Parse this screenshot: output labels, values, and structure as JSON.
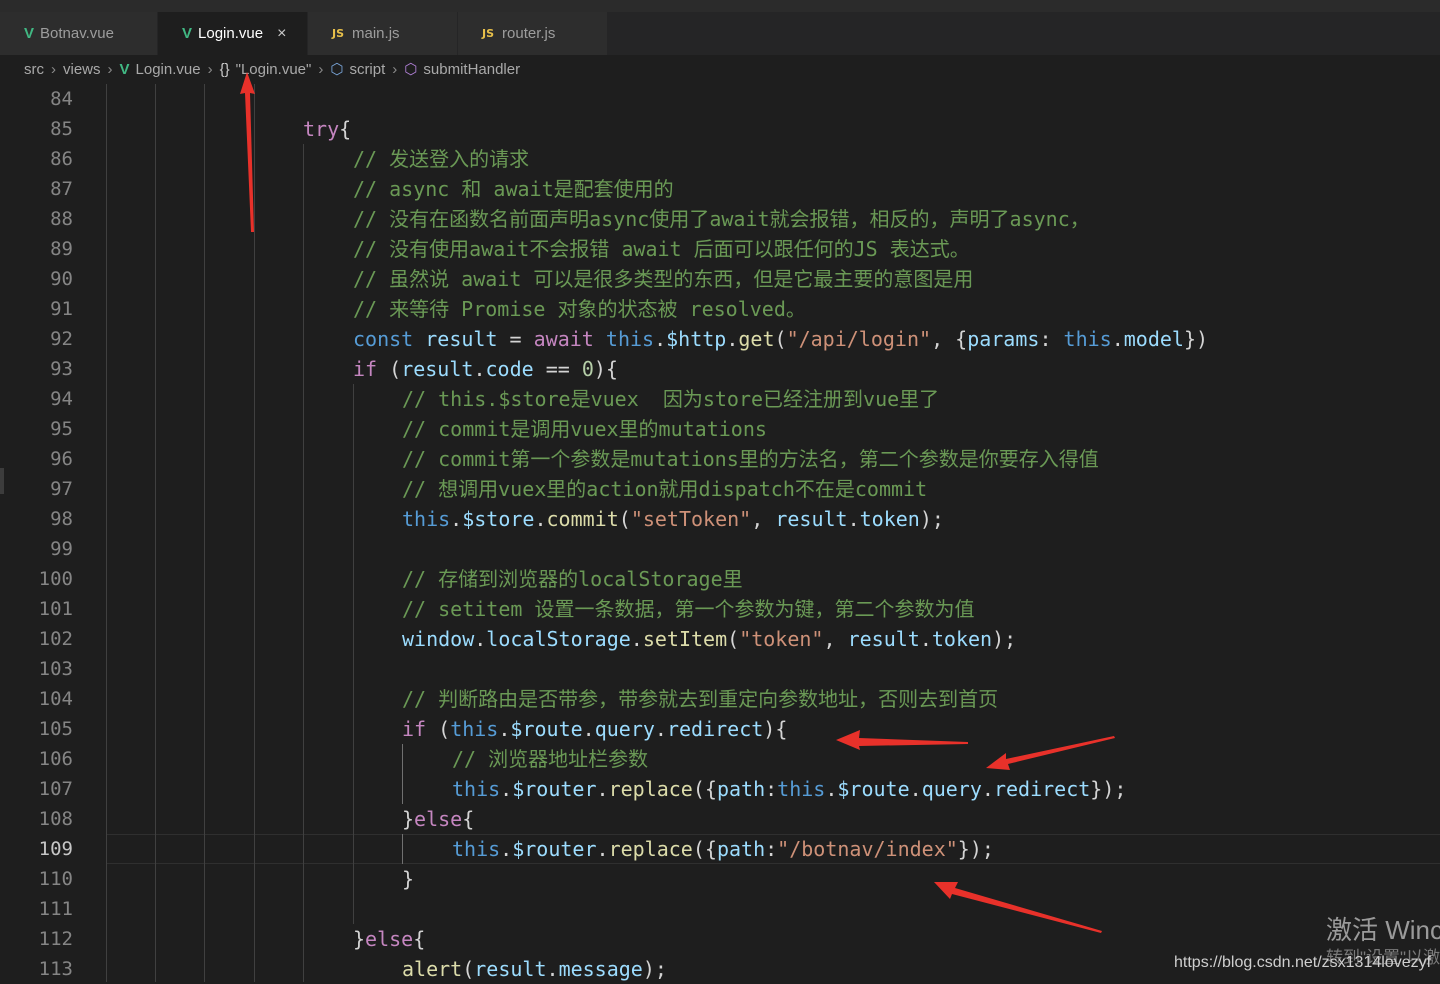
{
  "tabs": [
    {
      "label": "Botnav.vue",
      "icon": "vue-icon"
    },
    {
      "label": "Login.vue",
      "icon": "vue-icon",
      "close": "×"
    },
    {
      "label": "main.js",
      "icon": "js-icon",
      "icon_text": "JS"
    },
    {
      "label": "router.js",
      "icon": "js-icon",
      "icon_text": "JS"
    }
  ],
  "breadcrumb": {
    "src": "src",
    "views": "views",
    "file": "Login.vue",
    "component": "\"Login.vue\"",
    "script": "script",
    "method": "submitHandler",
    "braces": "{}"
  },
  "editor": {
    "current_line": "109",
    "line_numbers": [
      "84",
      "85",
      "86",
      "87",
      "88",
      "89",
      "90",
      "91",
      "92",
      "93",
      "94",
      "95",
      "96",
      "97",
      "98",
      "99",
      "100",
      "101",
      "102",
      "103",
      "104",
      "105",
      "106",
      "107",
      "108",
      "109",
      "110",
      "111",
      "112",
      "113"
    ],
    "tokens": {
      "l85": {
        "try": "try",
        "brace": "{"
      },
      "l86": "// 发送登入的请求",
      "l87": "// async 和 await是配套使用的",
      "l88": "// 没有在函数名前面声明async使用了await就会报错，相反的，声明了async，",
      "l89": "// 没有使用await不会报错 await 后面可以跟任何的JS 表达式。",
      "l90": "// 虽然说 await 可以是很多类型的东西，但是它最主要的意图是用",
      "l91": "// 来等待 Promise 对象的状态被 resolved。",
      "l92": {
        "const": "const",
        "result": "result",
        "eq": " = ",
        "await": "await",
        "this": "this",
        "dot1": ".",
        "http": "$http",
        "dot2": ".",
        "get": "get",
        "p1": "(",
        "url": "\"/api/login\"",
        "p2": ", {",
        "params": "params",
        "colon": ": ",
        "this2": "this",
        "dot3": ".",
        "model": "model",
        "p3": "})"
      },
      "l93": {
        "if": "if",
        "p1": " (",
        "result": "result",
        "dot": ".",
        "code": "code",
        "op": " == ",
        "zero": "0",
        "p2": "){"
      },
      "l94": "// this.$store是vuex  因为store已经注册到vue里了",
      "l95": "// commit是调用vuex里的mutations",
      "l96": "// commit第一个参数是mutations里的方法名，第二个参数是你要存入得值",
      "l97": "// 想调用vuex里的action就用dispatch不在是commit",
      "l98": {
        "this": "this",
        "dot1": ".",
        "store": "$store",
        "dot2": ".",
        "commit": "commit",
        "p1": "(",
        "key": "\"setToken\"",
        "comma": ", ",
        "result": "result",
        "dot3": ".",
        "token": "token",
        "p2": ");"
      },
      "l100": "// 存储到浏览器的localStorage里",
      "l101": "// setitem 设置一条数据，第一个参数为键，第二个参数为值",
      "l102": {
        "window": "window",
        "dot1": ".",
        "ls": "localStorage",
        "dot2": ".",
        "setItem": "setItem",
        "p1": "(",
        "key": "\"token\"",
        "comma": ", ",
        "result": "result",
        "dot3": ".",
        "token": "token",
        "p2": ");"
      },
      "l104": "// 判断路由是否带参，带参就去到重定向参数地址，否则去到首页",
      "l105": {
        "if": "if",
        "p1": " (",
        "this": "this",
        "dot1": ".",
        "route": "$route",
        "dot2": ".",
        "query": "query",
        "dot3": ".",
        "redirect": "redirect",
        "p2": "){"
      },
      "l106": "// 浏览器地址栏参数",
      "l107": {
        "this": "this",
        "dot1": ".",
        "router": "$router",
        "dot2": ".",
        "replace": "replace",
        "p1": "({",
        "path": "path",
        "colon": ":",
        "this2": "this",
        "dot3": ".",
        "route": "$route",
        "dot4": ".",
        "query": "query",
        "dot5": ".",
        "redirect": "redirect",
        "p2": "});"
      },
      "l108": {
        "close": "}",
        "else": "else",
        "open": "{"
      },
      "l109": {
        "this": "this",
        "dot1": ".",
        "router": "$router",
        "dot2": ".",
        "replace": "replace",
        "p1": "({",
        "path": "path",
        "colon": ":",
        "str": "\"/botnav/index\"",
        "p2": "});"
      },
      "l110": "}",
      "l112": {
        "close": "}",
        "else": "else",
        "open": "{"
      },
      "l113": {
        "alert": "alert",
        "p1": "(",
        "result": "result",
        "dot": ".",
        "message": "message",
        "p2": ");"
      }
    }
  },
  "watermark": {
    "activate": "激活 Winc",
    "settings": "转到\"设置\"以激",
    "url": "https://blog.csdn.net/zsx1314lovezyf"
  },
  "colors": {
    "background": "#1e1e1e",
    "annotation_arrow": "#e8312a"
  }
}
